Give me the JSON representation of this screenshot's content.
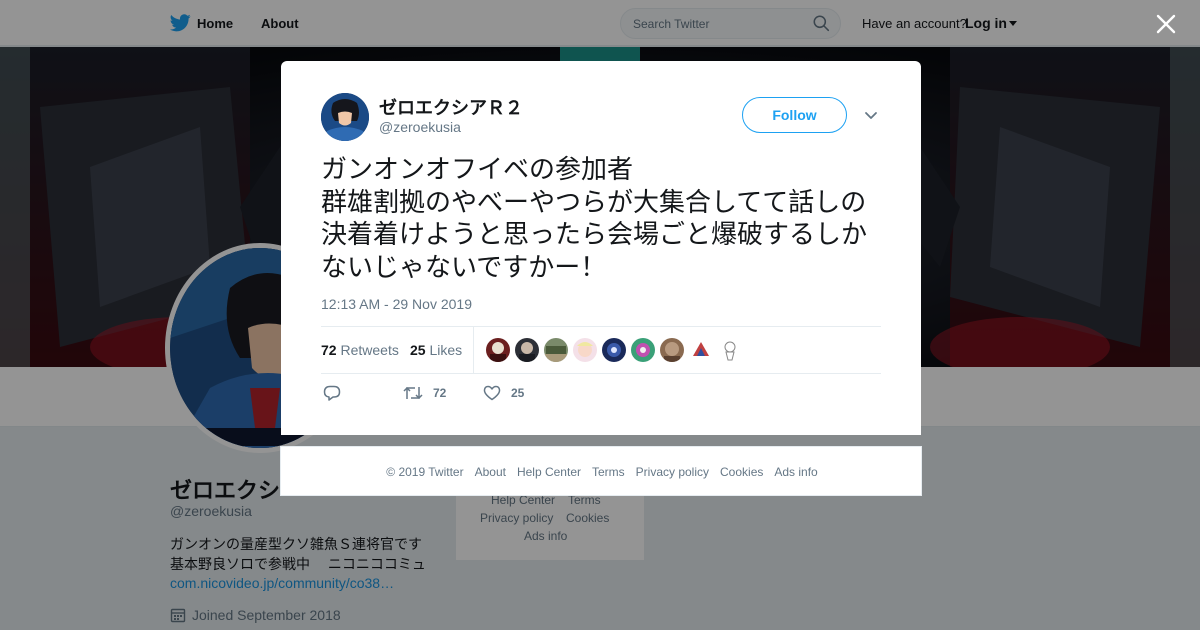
{
  "topbar": {
    "home_label": "Home",
    "about_label": "About",
    "search_placeholder": "Search Twitter",
    "account_prompt": "Have an account?",
    "login_label": "Log in"
  },
  "profile": {
    "name": "ゼロエクシ",
    "handle": "@zeroekusia",
    "bio_line1": "ガンオンの量産型クソ雑魚Ｓ連将官です",
    "bio_line2": "基本野良ソロで参戦中　 ニコニココミュ",
    "link": "com.nicovideo.jp/community/co38…",
    "joined": "Joined September 2018"
  },
  "side_footer": {
    "items": [
      "Help Center",
      "Terms",
      "Privacy policy",
      "Cookies",
      "Ads info"
    ]
  },
  "tweet": {
    "display_name": "ゼロエクシアＲ２",
    "handle": "@zeroekusia",
    "follow_label": "Follow",
    "text": "ガンオンオフイベの参加者\n群雄割拠のやべーやつらが大集合してて話しの決着着けようと思ったら会場ごと爆破するしかないじゃないですかー！",
    "timestamp": "12:13 AM - 29 Nov 2019",
    "retweets_count": "72",
    "retweets_label": "Retweets",
    "likes_count": "25",
    "likes_label": "Likes",
    "action_retweets": "72",
    "action_likes": "25"
  },
  "footer": {
    "copyright": "© 2019 Twitter",
    "about": "About",
    "help_center": "Help Center",
    "terms": "Terms",
    "privacy": "Privacy policy",
    "cookies": "Cookies",
    "ads_info": "Ads info"
  },
  "colors": {
    "twitter_blue": "#1da1f2",
    "link_blue": "#1b95e0",
    "text_gray": "#657786"
  }
}
